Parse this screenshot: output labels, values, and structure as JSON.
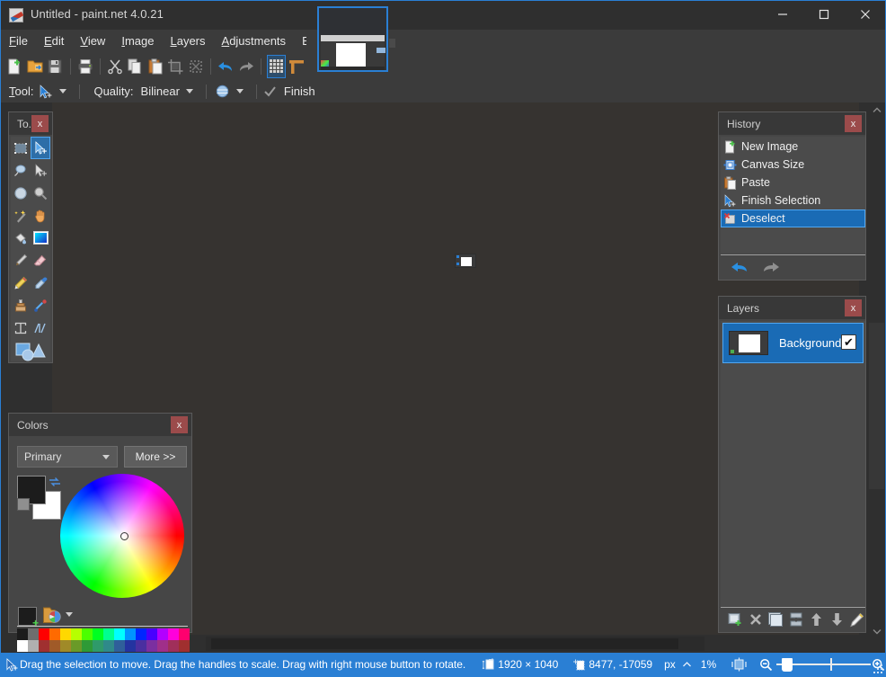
{
  "window": {
    "title": "Untitled - paint.net 4.0.21",
    "app_icon": "paintnet-icon",
    "minimize": "minimize-icon",
    "maximize": "maximize-icon",
    "close": "close-icon"
  },
  "menubar": {
    "items": [
      {
        "label": "File",
        "mnemonic": "F"
      },
      {
        "label": "Edit",
        "mnemonic": "E"
      },
      {
        "label": "View",
        "mnemonic": "V"
      },
      {
        "label": "Image",
        "mnemonic": "I"
      },
      {
        "label": "Layers",
        "mnemonic": "L"
      },
      {
        "label": "Adjustments",
        "mnemonic": "A"
      },
      {
        "label": "Effects",
        "mnemonic": "c"
      }
    ]
  },
  "toolbar": {
    "items": [
      {
        "name": "new-image",
        "icon": "new-file-icon"
      },
      {
        "name": "open-image",
        "icon": "open-folder-icon"
      },
      {
        "name": "save-image",
        "icon": "floppy-disk-icon"
      },
      {
        "name": "print-image",
        "icon": "printer-icon"
      },
      {
        "name": "cut",
        "icon": "scissors-icon"
      },
      {
        "name": "copy",
        "icon": "copy-icon"
      },
      {
        "name": "paste",
        "icon": "clipboard-icon"
      },
      {
        "name": "crop-to-selection",
        "icon": "crop-icon"
      },
      {
        "name": "deselect-all",
        "icon": "deselect-icon"
      },
      {
        "name": "undo",
        "icon": "undo-arrow-icon"
      },
      {
        "name": "redo",
        "icon": "redo-arrow-icon"
      },
      {
        "name": "toggle-pixel-grid",
        "icon": "grid-icon",
        "active": true
      },
      {
        "name": "toggle-rulers",
        "icon": "rulers-icon"
      }
    ]
  },
  "tool_options": {
    "tool_label": "Tool:",
    "tool_icon": "move-selection-icon",
    "quality_label": "Quality:",
    "quality_value": "Bilinear",
    "blend_icon": "blend-mode-icon",
    "finish_label": "Finish",
    "finish_icon": "checkmark-icon"
  },
  "titlebar_buttons": [
    {
      "name": "toggle-tools-window",
      "icon": "hammer-wrench-icon",
      "active": true
    },
    {
      "name": "toggle-history-window",
      "icon": "clock-icon",
      "active": true
    },
    {
      "name": "toggle-layers-window",
      "icon": "layers-stack-icon",
      "active": true
    },
    {
      "name": "toggle-colors-window",
      "icon": "color-wheel-icon",
      "active": true
    },
    {
      "name": "settings",
      "icon": "gear-icon",
      "active": false
    },
    {
      "name": "help",
      "icon": "question-mark-icon",
      "active": false
    }
  ],
  "tools_panel": {
    "title": "To...",
    "close_label": "x",
    "tools": [
      {
        "name": "rectangle-select",
        "icon": "rectangle-select-icon",
        "selected": false
      },
      {
        "name": "move-selected-pixels",
        "icon": "move-selected-icon",
        "selected": true
      },
      {
        "name": "lasso-select",
        "icon": "lasso-select-icon",
        "selected": false
      },
      {
        "name": "move-selection",
        "icon": "move-selection-arrow-icon",
        "selected": false
      },
      {
        "name": "ellipse-select",
        "icon": "ellipse-select-icon",
        "selected": false
      },
      {
        "name": "zoom",
        "icon": "magnifier-icon",
        "selected": false
      },
      {
        "name": "magic-wand",
        "icon": "magic-wand-icon",
        "selected": false
      },
      {
        "name": "pan",
        "icon": "hand-icon",
        "selected": false
      },
      {
        "name": "paint-bucket",
        "icon": "paint-bucket-icon",
        "selected": false
      },
      {
        "name": "gradient",
        "icon": "gradient-icon",
        "selected": false
      },
      {
        "name": "paintbrush",
        "icon": "paintbrush-icon",
        "selected": false
      },
      {
        "name": "eraser",
        "icon": "eraser-icon",
        "selected": false
      },
      {
        "name": "pencil",
        "icon": "pencil-icon",
        "selected": false
      },
      {
        "name": "color-picker",
        "icon": "eyedropper-icon",
        "selected": false
      },
      {
        "name": "clone-stamp",
        "icon": "clone-stamp-icon",
        "selected": false
      },
      {
        "name": "recolor",
        "icon": "recolor-icon",
        "selected": false
      },
      {
        "name": "text",
        "icon": "text-tool-icon",
        "selected": false
      },
      {
        "name": "line-curve",
        "icon": "line-curve-icon",
        "selected": false
      },
      {
        "name": "shapes",
        "icon": "shapes-icon",
        "selected": false
      }
    ]
  },
  "colors_panel": {
    "title": "Colors",
    "close_label": "x",
    "mode_value": "Primary",
    "more_label": "More >>",
    "primary_color": "#1c1c1c",
    "secondary_color": "#ffffff",
    "swap_icon": "swap-colors-icon",
    "reset_icon": "reset-colors-icon",
    "add_palette_icon": "add-color-icon",
    "open_palette_icon": "palette-icon",
    "palette_swatches_row1": [
      "#1c1c1c",
      "#6e6e6e",
      "#ff0000",
      "#ff6a00",
      "#ffd800",
      "#b6ff00",
      "#4cff00",
      "#00ff21",
      "#00ff90",
      "#00ffff",
      "#0094ff",
      "#0026ff",
      "#4800ff",
      "#b200ff",
      "#ff00dc",
      "#ff006e"
    ],
    "palette_swatches_row2": [
      "#ffffff",
      "#b0b0b0",
      "#a03030",
      "#a05a28",
      "#a08a28",
      "#6a9a28",
      "#2e9a36",
      "#2f9a6a",
      "#2f8a8a",
      "#2f5f9a",
      "#2433a0",
      "#4a2fa0",
      "#7b2fa0",
      "#a02f8a",
      "#a02f5a",
      "#a02f2f"
    ]
  },
  "history_panel": {
    "title": "History",
    "close_label": "x",
    "items": [
      {
        "label": "New Image",
        "icon": "new-image-icon",
        "selected": false
      },
      {
        "label": "Canvas Size",
        "icon": "canvas-size-icon",
        "selected": false
      },
      {
        "label": "Paste",
        "icon": "paste-icon",
        "selected": false
      },
      {
        "label": "Finish Selection",
        "icon": "finish-selection-icon",
        "selected": false
      },
      {
        "label": "Deselect",
        "icon": "deselect-icon",
        "selected": true
      }
    ],
    "undo_icon": "undo-arrow-icon",
    "redo_icon": "redo-arrow-icon"
  },
  "layers_panel": {
    "title": "Layers",
    "close_label": "x",
    "layers": [
      {
        "name": "Background",
        "visible": true,
        "selected": true
      }
    ],
    "visible_checkmark": "✔",
    "buttons": [
      {
        "name": "add-new-layer",
        "icon": "add-layer-icon"
      },
      {
        "name": "delete-layer",
        "icon": "delete-layer-icon"
      },
      {
        "name": "duplicate-layer",
        "icon": "duplicate-layer-icon"
      },
      {
        "name": "merge-layer-down",
        "icon": "merge-down-icon"
      },
      {
        "name": "move-layer-up",
        "icon": "arrow-up-icon"
      },
      {
        "name": "move-layer-down",
        "icon": "arrow-down-icon"
      },
      {
        "name": "layer-properties",
        "icon": "layer-properties-icon"
      }
    ]
  },
  "statusbar": {
    "cursor_icon": "move-selection-icon",
    "message": "Drag the selection to move. Drag the handles to scale. Drag with right mouse button to rotate.",
    "size_icon": "image-size-icon",
    "image_size": "1920 × 1040",
    "position_icon": "cursor-position-icon",
    "cursor_position": "8477, -17059",
    "units": "px",
    "units_caret": "caret-up-icon",
    "zoom_level": "1%",
    "fit_icon": "fit-to-window-icon",
    "zoom_out_icon": "zoom-out-icon",
    "zoom_in_icon": "zoom-in-icon",
    "resize_grip": "resize-grip-icon"
  },
  "canvas": {
    "thumbnail_name": "document-thumbnail",
    "mini_document": "mini-canvas-preview"
  },
  "colors": {
    "accent": "#2a7fd4",
    "status_bar": "#2a7fd4",
    "panel_bg": "#464646",
    "canvas_bg": "#363330",
    "chrome_bg": "#2f2f2f",
    "toolbar_bg": "#3b3b3b",
    "selection_blue": "#1a6bb5",
    "close_red": "#9b4b4b"
  }
}
